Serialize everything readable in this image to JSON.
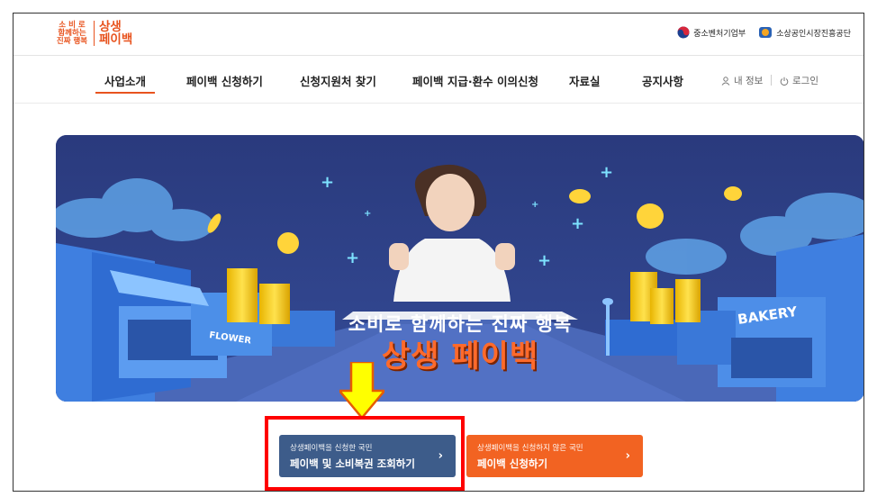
{
  "logo": {
    "small_line1": "소 비 로",
    "small_line2": "함께하는",
    "small_line3": "진짜 행복",
    "big_line1": "상생",
    "big_line2": "페이백"
  },
  "partners": [
    {
      "label": "중소벤처기업부"
    },
    {
      "label": "소상공인시장진흥공단"
    }
  ],
  "nav": {
    "items": [
      {
        "label": "사업소개",
        "active": true
      },
      {
        "label": "페이백 신청하기"
      },
      {
        "label": "신청지원처 찾기"
      },
      {
        "label": "페이백 지급·환수 이의신청"
      },
      {
        "label": "자료실"
      },
      {
        "label": "공지사항"
      }
    ],
    "my_info": "내 정보",
    "login": "로그인"
  },
  "banner": {
    "headline": "소비로 함께하는 진짜 행복",
    "brand": "상생 페이백",
    "bakery_sign": "BAKERY",
    "flower_sign": "FLOWER"
  },
  "buttons": {
    "query": {
      "sub": "상생페이백을 신청한 국민",
      "main": "페이백 및 소비복권 조회하기"
    },
    "apply": {
      "sub": "상생페이백을 신청하지 않은 국민",
      "main": "페이백 신청하기"
    }
  },
  "colors": {
    "brand_orange": "#e8541f",
    "query_blue": "#3d5c8a",
    "highlight_red": "#ff0000",
    "arrow_yellow": "#ffff00"
  }
}
